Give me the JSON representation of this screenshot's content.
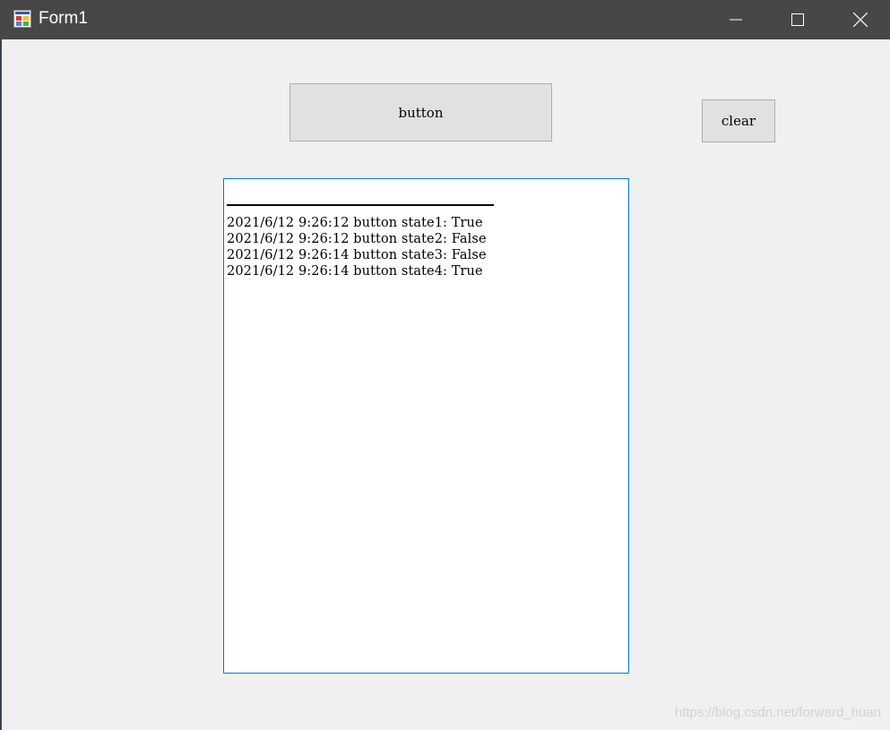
{
  "window": {
    "title": "Form1",
    "icon": "winforms-app-icon",
    "controls": {
      "minimize_icon": "minimize-icon",
      "maximize_icon": "maximize-icon",
      "close_icon": "close-icon"
    }
  },
  "buttons": {
    "main_label": "button",
    "clear_label": "clear"
  },
  "log": {
    "separator": "________________________________",
    "lines": [
      "2021/6/12 9:26:12 button state1: True",
      "2021/6/12 9:26:12 button state2: False",
      "2021/6/12 9:26:14 button state3: False",
      "2021/6/12 9:26:14 button state4: True"
    ]
  },
  "watermark": "https://blog.csdn.net/forward_huan",
  "colors": {
    "titlebar": "#474747",
    "form_background": "#f0f0f0",
    "textbox_focus_border": "#0078d7",
    "button_face": "#e1e1e1"
  }
}
